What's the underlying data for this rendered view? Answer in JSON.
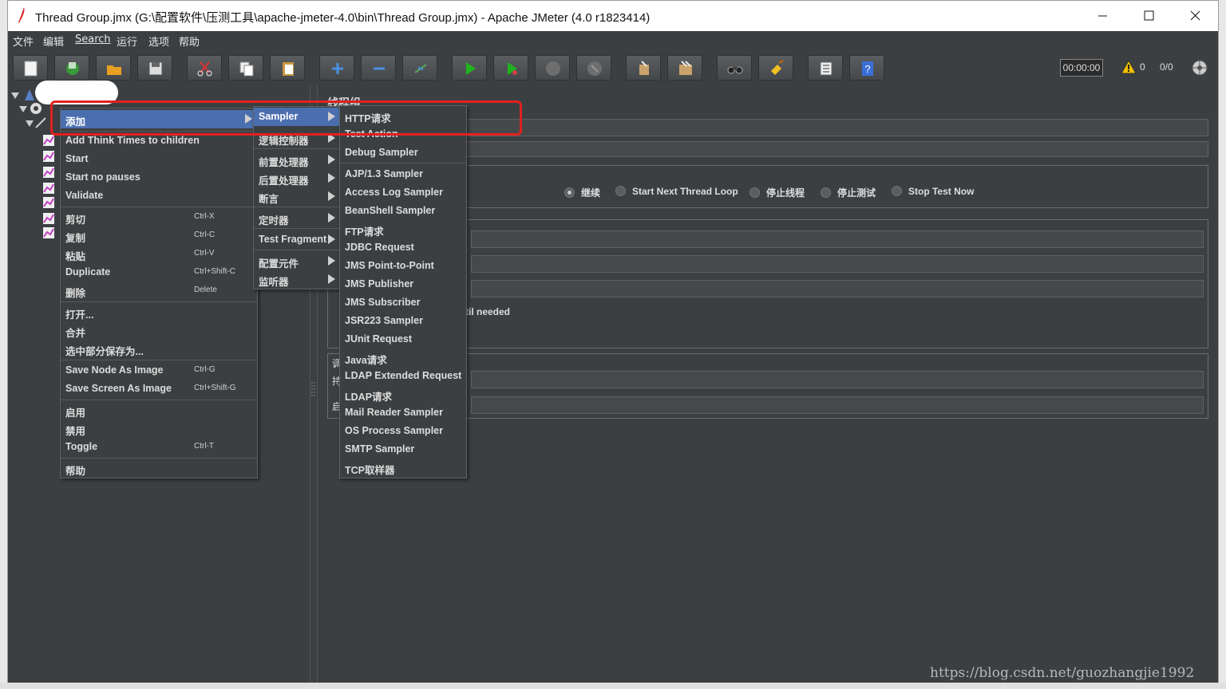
{
  "window": {
    "title": "Thread Group.jmx (G:\\配置软件\\压测工具\\apache-jmeter-4.0\\bin\\Thread Group.jmx) - Apache JMeter (4.0 r1823414)"
  },
  "menubar": [
    "文件",
    "编辑",
    "Search",
    "运行",
    "选项",
    "帮助"
  ],
  "toolbar": {
    "timer": "00:00:00",
    "warnings": "0",
    "threads": "0/0",
    "buttons": [
      "new-icon",
      "templates-icon",
      "open-icon",
      "save-icon",
      "cut-icon",
      "copy-icon",
      "paste-icon",
      "expand-icon",
      "collapse-icon",
      "toggle-icon",
      "start-icon",
      "start-no-pause-icon",
      "stop-icon",
      "shutdown-icon",
      "clear-icon",
      "clear-all-icon",
      "search-icon",
      "reset-search-icon",
      "function-helper-icon",
      "help-icon"
    ]
  },
  "right_panel": {
    "title": "线程组",
    "fragments": {
      "until_needed": "til needed",
      "c1": "调",
      "c2": "持",
      "c3": "启"
    },
    "radios": [
      {
        "label": "继续",
        "checked": true
      },
      {
        "label": "Start Next Thread Loop",
        "checked": false
      },
      {
        "label": "停止线程",
        "checked": false
      },
      {
        "label": "停止测试",
        "checked": false
      },
      {
        "label": "Stop Test Now",
        "checked": false
      }
    ]
  },
  "context_menu": {
    "items": [
      {
        "label": "添加",
        "submenu": true,
        "selected": true
      },
      {
        "label": "Add Think Times to children"
      },
      {
        "label": "Start"
      },
      {
        "label": "Start no pauses"
      },
      {
        "label": "Validate"
      },
      {
        "label": "剪切",
        "shortcut": "Ctrl-X"
      },
      {
        "label": "复制",
        "shortcut": "Ctrl-C"
      },
      {
        "label": "粘贴",
        "shortcut": "Ctrl-V"
      },
      {
        "label": "Duplicate",
        "shortcut": "Ctrl+Shift-C"
      },
      {
        "label": "删除",
        "shortcut": "Delete"
      },
      {
        "label": "打开..."
      },
      {
        "label": "合并"
      },
      {
        "label": "选中部分保存为..."
      },
      {
        "label": "Save Node As Image",
        "shortcut": "Ctrl-G"
      },
      {
        "label": "Save Screen As Image",
        "shortcut": "Ctrl+Shift-G"
      },
      {
        "label": "启用"
      },
      {
        "label": "禁用"
      },
      {
        "label": "Toggle",
        "shortcut": "Ctrl-T"
      },
      {
        "label": "帮助"
      }
    ]
  },
  "add_submenu": {
    "items": [
      "Sampler",
      "逻辑控制器",
      "前置处理器",
      "后置处理器",
      "断言",
      "定时器",
      "Test Fragment",
      "配置元件",
      "监听器"
    ]
  },
  "sampler_submenu": {
    "items": [
      "HTTP请求",
      "Test Action",
      "Debug Sampler",
      "AJP/1.3 Sampler",
      "Access Log Sampler",
      "BeanShell Sampler",
      "FTP请求",
      "JDBC Request",
      "JMS Point-to-Point",
      "JMS Publisher",
      "JMS Subscriber",
      "JSR223 Sampler",
      "JUnit Request",
      "Java请求",
      "LDAP Extended Request",
      "LDAP请求",
      "Mail Reader Sampler",
      "OS Process Sampler",
      "SMTP Sampler",
      "TCP取样器"
    ]
  },
  "watermark": "https://blog.csdn.net/guozhangjie1992"
}
